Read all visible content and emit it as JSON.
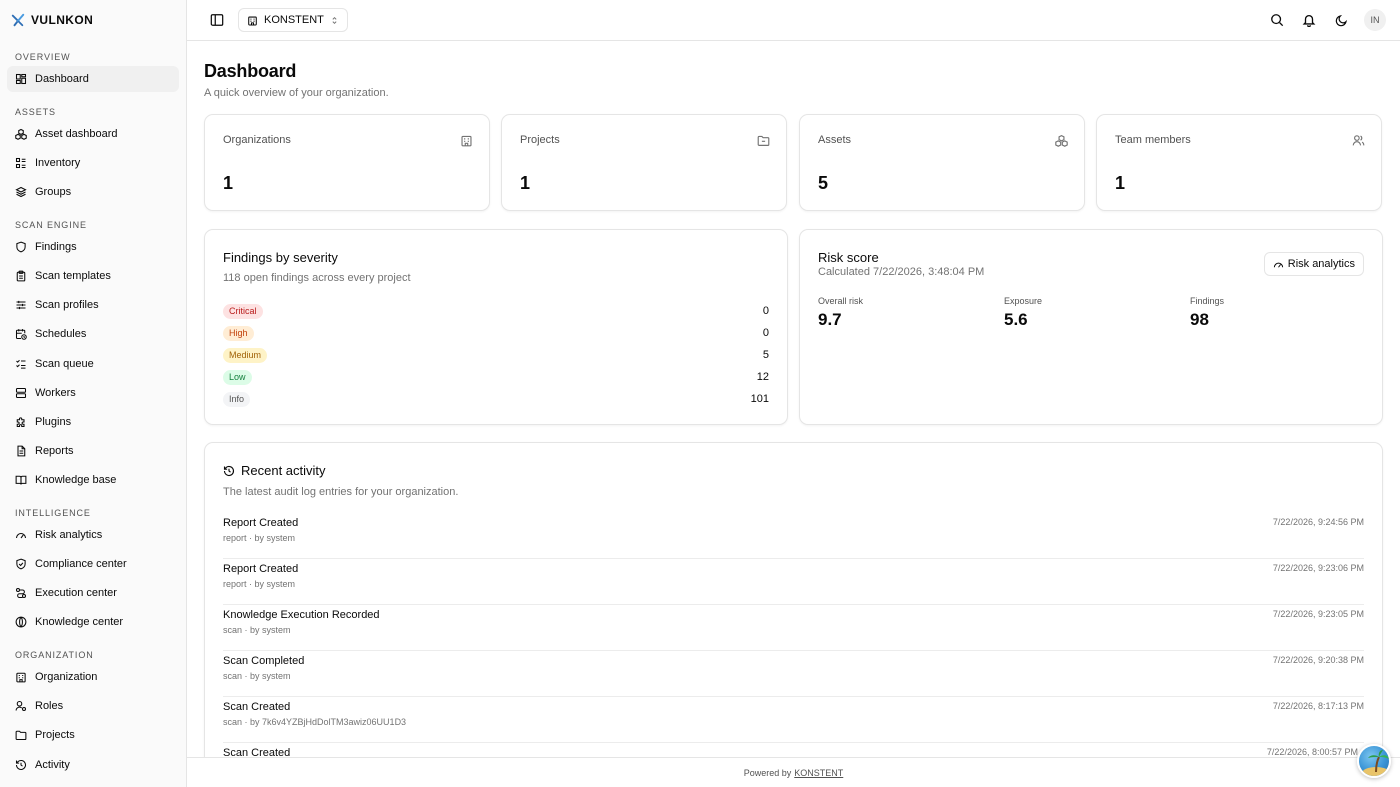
{
  "brand": {
    "name": "VULNKON"
  },
  "sidebar": {
    "sections": [
      {
        "label": "OVERVIEW",
        "items": [
          {
            "label": "Dashboard",
            "icon": "dashboard-icon",
            "active": true
          }
        ]
      },
      {
        "label": "ASSETS",
        "items": [
          {
            "label": "Asset dashboard",
            "icon": "boxes-icon"
          },
          {
            "label": "Inventory",
            "icon": "list-icon"
          },
          {
            "label": "Groups",
            "icon": "layers-icon"
          }
        ]
      },
      {
        "label": "SCAN ENGINE",
        "items": [
          {
            "label": "Findings",
            "icon": "shield-icon"
          },
          {
            "label": "Scan templates",
            "icon": "clipboard-icon"
          },
          {
            "label": "Scan profiles",
            "icon": "sliders-icon"
          },
          {
            "label": "Schedules",
            "icon": "calendar-clock-icon"
          },
          {
            "label": "Scan queue",
            "icon": "checklist-icon"
          },
          {
            "label": "Workers",
            "icon": "server-icon"
          },
          {
            "label": "Plugins",
            "icon": "puzzle-icon"
          },
          {
            "label": "Reports",
            "icon": "file-icon"
          },
          {
            "label": "Knowledge base",
            "icon": "book-icon"
          }
        ]
      },
      {
        "label": "INTELLIGENCE",
        "items": [
          {
            "label": "Risk analytics",
            "icon": "gauge-icon"
          },
          {
            "label": "Compliance center",
            "icon": "shield-check-icon"
          },
          {
            "label": "Execution center",
            "icon": "route-icon"
          },
          {
            "label": "Knowledge center",
            "icon": "globe-icon"
          }
        ]
      },
      {
        "label": "ORGANIZATION",
        "items": [
          {
            "label": "Organization",
            "icon": "building-icon"
          },
          {
            "label": "Roles",
            "icon": "user-cog-icon"
          },
          {
            "label": "Projects",
            "icon": "folder-icon"
          },
          {
            "label": "Activity",
            "icon": "history-icon"
          }
        ]
      }
    ]
  },
  "topbar": {
    "org_name": "KONSTENT",
    "avatar_initials": "IN"
  },
  "page": {
    "title": "Dashboard",
    "subtitle": "A quick overview of your organization."
  },
  "stats": [
    {
      "label": "Organizations",
      "value": "1",
      "icon": "building-icon"
    },
    {
      "label": "Projects",
      "value": "1",
      "icon": "folder-icon"
    },
    {
      "label": "Assets",
      "value": "5",
      "icon": "boxes-icon"
    },
    {
      "label": "Team members",
      "value": "1",
      "icon": "users-icon"
    }
  ],
  "findings": {
    "title": "Findings by severity",
    "subtitle": "118 open findings across every project",
    "rows": [
      {
        "label": "Critical",
        "count": "0",
        "bg": "#fde2e2",
        "fg": "#b91c1c"
      },
      {
        "label": "High",
        "count": "0",
        "bg": "#ffedd5",
        "fg": "#c2410c"
      },
      {
        "label": "Medium",
        "count": "5",
        "bg": "#fef3c7",
        "fg": "#a16207"
      },
      {
        "label": "Low",
        "count": "12",
        "bg": "#dcfce7",
        "fg": "#15803d"
      },
      {
        "label": "Info",
        "count": "101",
        "bg": "#f3f4f6",
        "fg": "#525252"
      }
    ]
  },
  "risk": {
    "title": "Risk score",
    "calculated": "Calculated 7/22/2026, 3:48:04 PM",
    "button_label": "Risk analytics",
    "metrics": [
      {
        "label": "Overall risk",
        "value": "9.7"
      },
      {
        "label": "Exposure",
        "value": "5.6"
      },
      {
        "label": "Findings",
        "value": "98"
      }
    ]
  },
  "activity": {
    "title": "Recent activity",
    "subtitle": "The latest audit log entries for your organization.",
    "rows": [
      {
        "title": "Report Created",
        "meta": "report · by system",
        "time": "7/22/2026, 9:24:56 PM"
      },
      {
        "title": "Report Created",
        "meta": "report · by system",
        "time": "7/22/2026, 9:23:06 PM"
      },
      {
        "title": "Knowledge Execution Recorded",
        "meta": "scan · by system",
        "time": "7/22/2026, 9:23:05 PM"
      },
      {
        "title": "Scan Completed",
        "meta": "scan · by system",
        "time": "7/22/2026, 9:20:38 PM"
      },
      {
        "title": "Scan Created",
        "meta": "scan · by 7k6v4YZBjHdDolTM3awiz06UU1D3",
        "time": "7/22/2026, 8:17:13 PM"
      },
      {
        "title": "Scan Created",
        "meta": "",
        "time": "7/22/2026, 8:00:57 PM"
      }
    ]
  },
  "footer": {
    "prefix": "Powered by",
    "link": "KONSTENT"
  }
}
